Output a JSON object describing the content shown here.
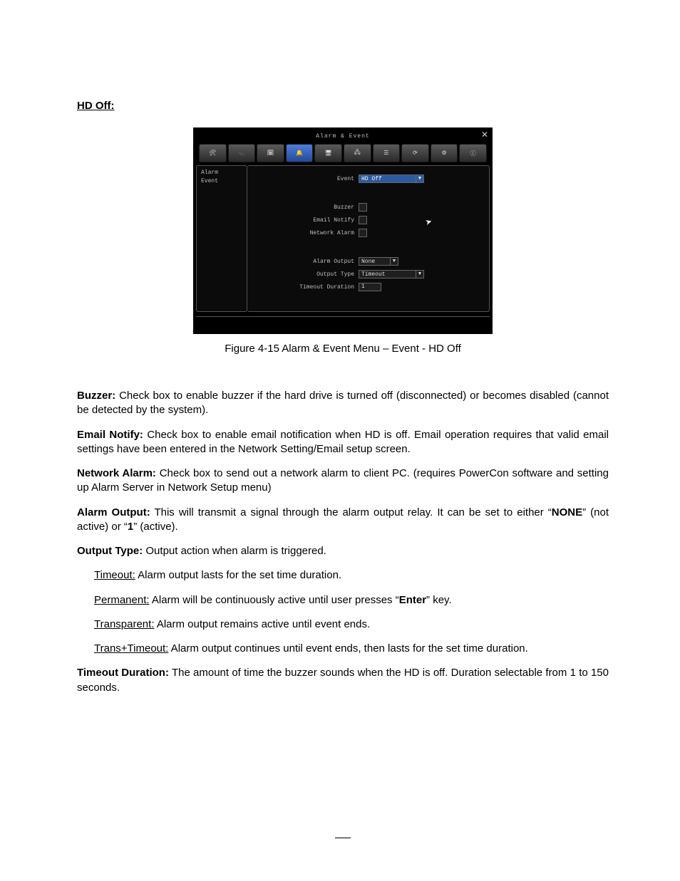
{
  "section_title": "HD Off:",
  "shot": {
    "title": "Alarm & Event",
    "close": "✕",
    "sidebar": {
      "alarm": "Alarm",
      "event": "Event"
    },
    "fields": {
      "event_label": "Event",
      "event_value": "HD Off",
      "buzzer_label": "Buzzer",
      "email_label": "Email Notify",
      "network_label": "Network Alarm",
      "alarm_output_label": "Alarm Output",
      "alarm_output_value": "None",
      "output_type_label": "Output Type",
      "output_type_value": "Timeout",
      "timeout_label": "Timeout Duration",
      "timeout_value": "1"
    }
  },
  "caption": "Figure 4-15 Alarm & Event Menu – Event - HD Off",
  "para": {
    "buzzer_b": "Buzzer:",
    "buzzer_t": " Check box to enable buzzer if the hard drive is turned off (disconnected) or becomes disabled (cannot be detected by the system).",
    "email_b": "Email Notify:",
    "email_t": " Check box to enable email notification when HD is off.  Email operation requires that valid email settings have been entered in the Network Setting/Email setup screen.",
    "network_b": "Network Alarm:",
    "network_t": " Check box to send out a network alarm to client PC. (requires PowerCon software and setting up Alarm Server in Network Setup menu)",
    "alarmout_b": "Alarm Output:",
    "alarmout_t1": " This will transmit a signal through the alarm output relay. It can be set to either “",
    "alarmout_none": "NONE",
    "alarmout_t2": "” (not active) or “",
    "alarmout_one": "1",
    "alarmout_t3": "” (active).",
    "outtype_b": "Output Type:",
    "outtype_t": " Output action when alarm is triggered.",
    "timeout_u": "Timeout:",
    "timeout_t": " Alarm output lasts for the set time duration.",
    "perm_u": "Permanent:",
    "perm_t1": " Alarm will be continuously active until user presses “",
    "perm_enter": "Enter",
    "perm_t2": "” key.",
    "trans_u": "Transparent:",
    "trans_t": " Alarm output remains active until event ends.",
    "tt_u": "Trans+Timeout:",
    "tt_t": " Alarm output continues until event ends, then lasts for the set time duration.",
    "tdur_b": "Timeout Duration:",
    "tdur_t": " The amount of time the buzzer sounds when the HD is off. Duration selectable from 1 to 150 seconds."
  }
}
